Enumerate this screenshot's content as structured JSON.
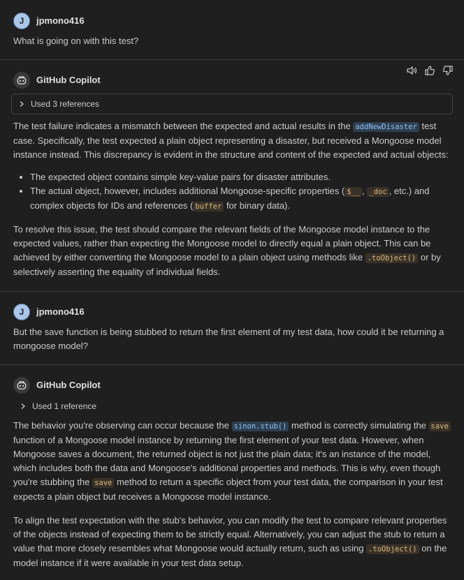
{
  "messages": [
    {
      "author": "jpmono416",
      "avatar_letter": "J",
      "text": "What is going on with this test?"
    },
    {
      "author": "GitHub Copilot",
      "references": "Used 3 references",
      "p1": {
        "a": "The test failure indicates a mismatch between the expected and actual results in the ",
        "code": "addNewDisaster",
        "b": " test case. Specifically, the test expected a plain object representing a disaster, but received a Mongoose model instance instead. This discrepancy is evident in the structure and content of the expected and actual objects:"
      },
      "bullets": [
        {
          "text": "The expected object contains simple key-value pairs for disaster attributes."
        },
        {
          "a": "The actual object, however, includes additional Mongoose-specific properties (",
          "c1": "$__",
          "sep": ", ",
          "c2": "_doc",
          "b": ", etc.) and complex objects for IDs and references (",
          "c3": "buffer",
          "c": " for binary data)."
        }
      ],
      "p2": {
        "a": "To resolve this issue, the test should compare the relevant fields of the Mongoose model instance to the expected values, rather than expecting the Mongoose model to directly equal a plain object. This can be achieved by either converting the Mongoose model to a plain object using methods like ",
        "code": ".toObject()",
        "b": " or by selectively asserting the equality of individual fields."
      }
    },
    {
      "author": "jpmono416",
      "avatar_letter": "J",
      "text": "But the save function is being stubbed to return the first element of my test data, how could it be returning a mongoose model?"
    },
    {
      "author": "GitHub Copilot",
      "references": "Used 1 reference",
      "p1": {
        "a": "The behavior you're observing can occur because the ",
        "c1": "sinon.stub()",
        "b": " method is correctly simulating the ",
        "c2": "save",
        "c": " function of a Mongoose model instance by returning the first element of your test data. However, when Mongoose saves a document, the returned object is not just the plain data; it's an instance of the model, which includes both the data and Mongoose's additional properties and methods. This is why, even though you're stubbing the ",
        "c3": "save",
        "d": " method to return a specific object from your test data, the comparison in your test expects a plain object but receives a Mongoose model instance."
      },
      "p2": {
        "a": "To align the test expectation with the stub's behavior, you can modify the test to compare relevant properties of the objects instead of expecting them to be strictly equal. Alternatively, you can adjust the stub to return a value that more closely resembles what Mongoose would actually return, such as using ",
        "code": ".toObject()",
        "b": " on the model instance if it were available in your test data setup."
      }
    }
  ],
  "icons": {
    "speaker": "speaker-icon",
    "thumbs_up": "thumbs-up-icon",
    "thumbs_down": "thumbs-down-icon",
    "chevron": "chevron-right-icon",
    "copilot": "copilot-icon"
  }
}
